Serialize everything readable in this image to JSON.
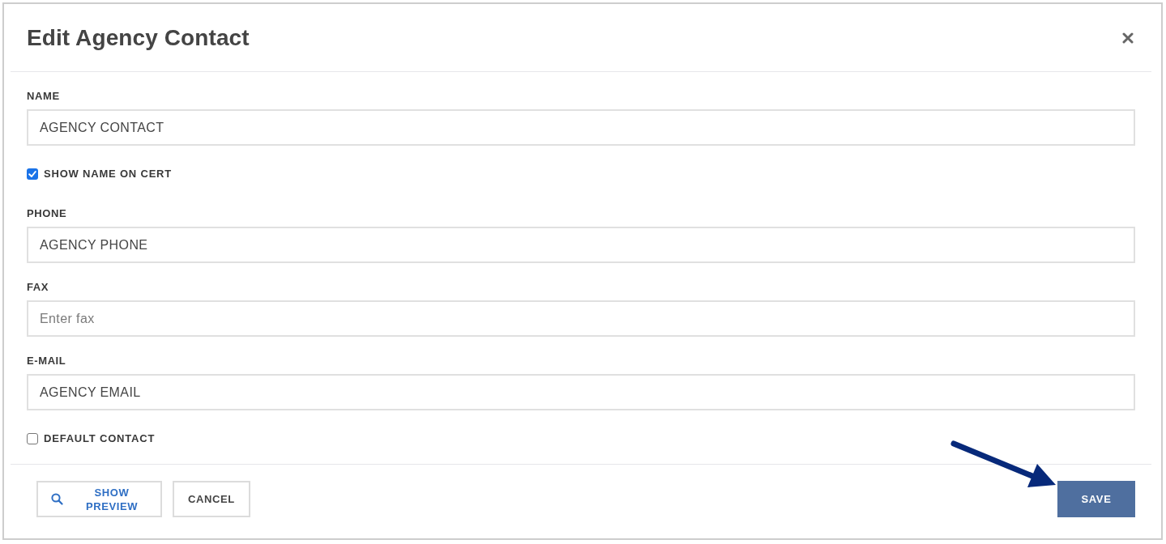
{
  "dialog": {
    "title": "Edit Agency Contact"
  },
  "fields": [
    {
      "kind": "text",
      "label": "NAME",
      "value": "AGENCY CONTACT"
    },
    {
      "kind": "checkbox",
      "label": "SHOW NAME ON CERT",
      "checked": true
    },
    {
      "kind": "text",
      "label": "PHONE",
      "value": "AGENCY PHONE"
    },
    {
      "kind": "text",
      "label": "FAX",
      "placeholder": "Enter fax"
    },
    {
      "kind": "text",
      "label": "E-MAIL",
      "value": "AGENCY EMAIL"
    },
    {
      "kind": "checkbox",
      "label": "DEFAULT CONTACT",
      "checked": false
    }
  ],
  "buttons": [
    {
      "kind": "preview",
      "label": "SHOW PREVIEW"
    },
    {
      "kind": "outline",
      "label": "CANCEL"
    },
    {
      "kind": "primary",
      "label": "SAVE"
    }
  ]
}
